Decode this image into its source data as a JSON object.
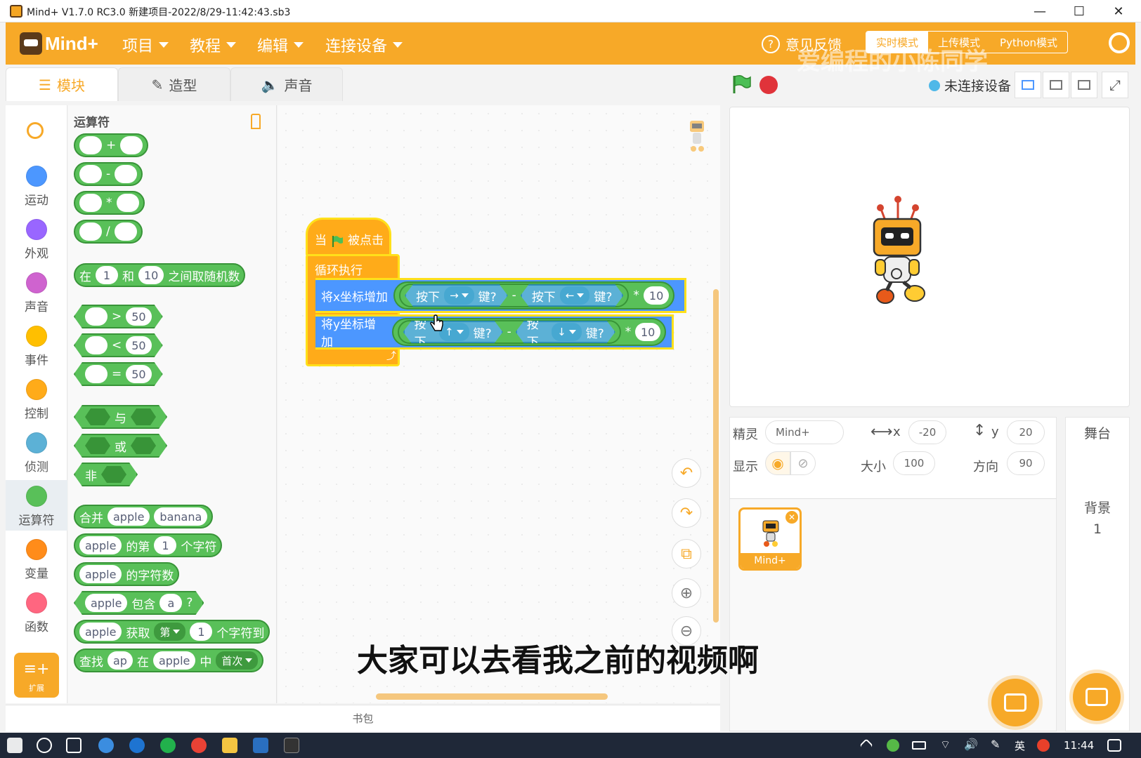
{
  "window": {
    "title": "Mind+ V1.7.0 RC3.0    新建项目-2022/8/29-11:42:43.sb3",
    "minimize": "—",
    "maximize": "☐",
    "close": "✕"
  },
  "menubar": {
    "logo": "Mind+",
    "menus": [
      "项目",
      "教程",
      "编辑",
      "连接设备"
    ],
    "feedback": "意见反馈",
    "modes": [
      "实时模式",
      "上传模式",
      "Python模式"
    ],
    "watermark": "爱编程的小陈同学"
  },
  "tabs": [
    "模块",
    "造型",
    "声音"
  ],
  "stage_controls": {
    "device_status": "未连接设备"
  },
  "categories": [
    {
      "label": "运动",
      "color": "#4c97ff"
    },
    {
      "label": "外观",
      "color": "#9966ff"
    },
    {
      "label": "声音",
      "color": "#cf63cf"
    },
    {
      "label": "事件",
      "color": "#ffbf00"
    },
    {
      "label": "控制",
      "color": "#ffab19"
    },
    {
      "label": "侦测",
      "color": "#5cb1d6"
    },
    {
      "label": "运算符",
      "color": "#59c059"
    },
    {
      "label": "变量",
      "color": "#ff8c1a"
    },
    {
      "label": "函数",
      "color": "#ff6680"
    }
  ],
  "extension_label": "扩展",
  "palette": {
    "title": "运算符",
    "ops": [
      "+",
      "-",
      "*",
      "/"
    ],
    "random": {
      "prefix": "在",
      "from": "1",
      "mid": "和",
      "to": "10",
      "suffix": "之间取随机数"
    },
    "compare": [
      {
        "op": ">",
        "value": "50"
      },
      {
        "op": "<",
        "value": "50"
      },
      {
        "op": "=",
        "value": "50"
      }
    ],
    "logic": [
      "与",
      "或",
      "非"
    ],
    "join": {
      "label": "合并",
      "a": "apple",
      "b": "banana"
    },
    "letter": {
      "a": "apple",
      "mid": "的第",
      "n": "1",
      "suffix": "个字符"
    },
    "length": {
      "a": "apple",
      "suffix": "的字符数"
    },
    "contains": {
      "a": "apple",
      "mid": "包含",
      "b": "a",
      "suffix": "?"
    },
    "substring": {
      "a": "apple",
      "mid": "获取",
      "drop": "第",
      "n": "1",
      "suffix": "个字符到"
    },
    "find": {
      "label": "查找",
      "a": "ap",
      "mid": "在",
      "b": "apple",
      "mid2": "中",
      "drop": "首次"
    }
  },
  "script": {
    "hat": {
      "prefix": "当",
      "suffix": "被点击"
    },
    "loop": "循环执行",
    "row_x": {
      "label": "将x坐标增加",
      "press": "按下",
      "key1": "→",
      "key_suffix": "键?",
      "minus": "-",
      "key2": "←",
      "times": "*",
      "value": "10"
    },
    "row_y": {
      "label": "将y坐标增加",
      "press": "按下",
      "key1": "↑",
      "key_suffix": "键?",
      "minus": "-",
      "key2": "↓",
      "times": "*",
      "value": "10"
    }
  },
  "backpack": "书包",
  "sprite_info": {
    "sprite_label": "精灵",
    "sprite_name": "Mind+",
    "x_label": "x",
    "x": "-20",
    "y_label": "y",
    "y": "20",
    "show_label": "显示",
    "size_label": "大小",
    "size": "100",
    "direction_label": "方向",
    "direction": "90"
  },
  "sprite_list": [
    {
      "name": "Mind+"
    }
  ],
  "stage_panel": {
    "title": "舞台",
    "backdrop_label": "背景",
    "backdrop_count": "1"
  },
  "subtitle": "大家可以去看我之前的视频啊",
  "taskbar": {
    "ime": "英",
    "clock": "11:44"
  }
}
